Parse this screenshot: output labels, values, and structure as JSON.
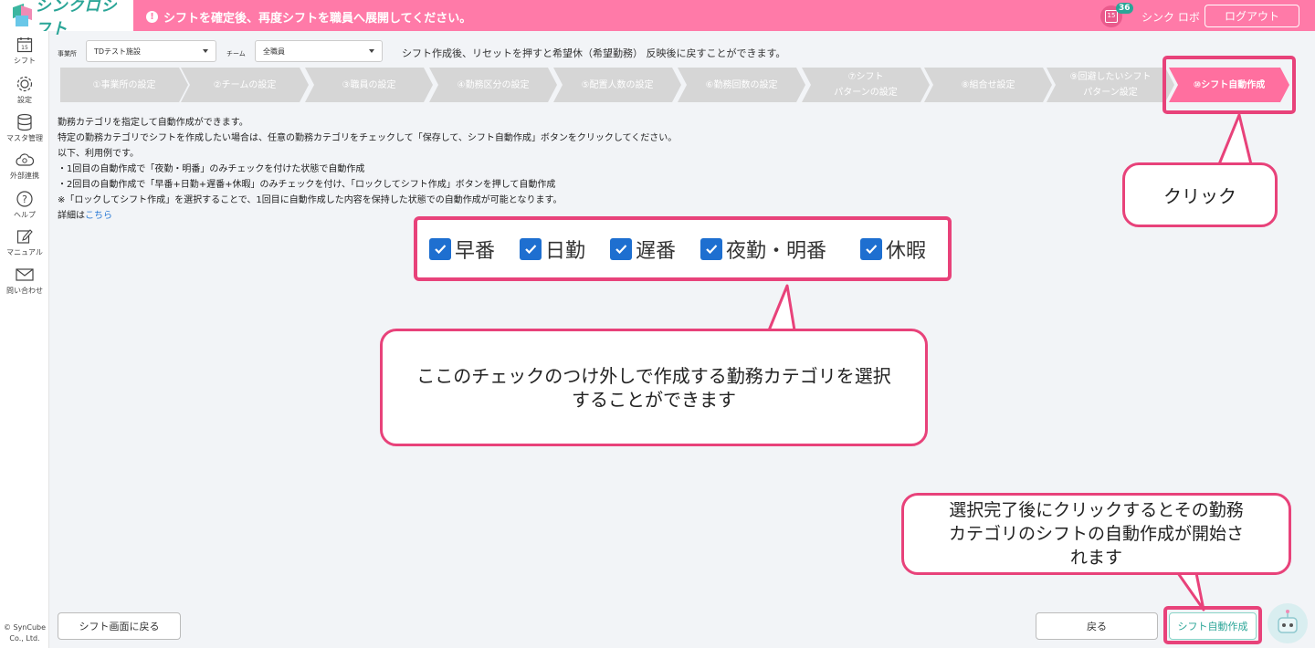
{
  "header": {
    "logo_text": "シンクロシフト",
    "notice": "シフトを確定後、再度シフトを職員へ展開してください。",
    "calendar_badge": "36",
    "calendar_day": "15",
    "user_name": "シンク ロボ",
    "logout_label": "ログアウト",
    "accent_color": "#ff7aa8"
  },
  "sidebar": {
    "items": [
      {
        "label": "シフト",
        "icon": "calendar-icon"
      },
      {
        "label": "設定",
        "icon": "gear-icon"
      },
      {
        "label": "マスタ管理",
        "icon": "database-icon"
      },
      {
        "label": "外部連携",
        "icon": "cloud-sync-icon"
      },
      {
        "label": "ヘルプ",
        "icon": "help-icon"
      },
      {
        "label": "マニュアル",
        "icon": "edit-icon"
      },
      {
        "label": "問い合わせ",
        "icon": "mail-icon"
      }
    ],
    "copyright_1": "© SynCube",
    "copyright_2": "Co., Ltd."
  },
  "filters": {
    "office_label": "事業所",
    "office_value": "TDテスト施設",
    "team_label": "チーム",
    "team_value": "全職員",
    "info": "シフト作成後、リセットを押すと希望休（希望勤務） 反映後に戻すことができます。"
  },
  "steps": [
    {
      "line1": "①事業所の設定",
      "line2": ""
    },
    {
      "line1": "②チームの設定",
      "line2": ""
    },
    {
      "line1": "③職員の設定",
      "line2": ""
    },
    {
      "line1": "④勤務区分の設定",
      "line2": ""
    },
    {
      "line1": "⑤配置人数の設定",
      "line2": ""
    },
    {
      "line1": "⑥勤務回数の設定",
      "line2": ""
    },
    {
      "line1": "⑦シフト",
      "line2": "パターンの設定"
    },
    {
      "line1": "⑧組合せ設定",
      "line2": ""
    },
    {
      "line1": "⑨回避したいシフト",
      "line2": "パターン設定"
    },
    {
      "line1": "⑩シフト自動作成",
      "line2": ""
    }
  ],
  "description": {
    "line1": "勤務カテゴリを指定して自動作成ができます。",
    "line2": "特定の勤務カテゴリでシフトを作成したい場合は、任意の勤務カテゴリをチェックして「保存して、シフト自動作成」ボタンをクリックしてください。",
    "line3": "以下、利用例です。",
    "line4": "・1回目の自動作成で「夜勤・明番」のみチェックを付けた状態で自動作成",
    "line5": "・2回目の自動作成で「早番+日勤+遅番+休暇」のみチェックを付け、「ロックしてシフト作成」ボタンを押して自動作成",
    "line6": "※「ロックしてシフト作成」を選択することで、1回目に自動作成した内容を保持した状態での自動作成が可能となります。",
    "detail_prefix": "詳細は",
    "detail_link": "こちら"
  },
  "categories": [
    {
      "label": "早番",
      "checked": true
    },
    {
      "label": "日勤",
      "checked": true
    },
    {
      "label": "遅番",
      "checked": true
    },
    {
      "label": "夜勤・明番",
      "checked": true
    },
    {
      "label": "休暇",
      "checked": true
    }
  ],
  "callouts": {
    "click": "クリック",
    "checkbox_line1": "ここのチェックのつけ外しで作成する勤務カテゴリを選択",
    "checkbox_line2": "することができます",
    "auto_line1": "選択完了後にクリックするとその勤務",
    "auto_line2": "カテゴリのシフトの自動作成が開始さ",
    "auto_line3": "れます"
  },
  "buttons": {
    "back_to_shift": "シフト画面に戻る",
    "back": "戻る",
    "auto_create": "シフト自動作成"
  }
}
